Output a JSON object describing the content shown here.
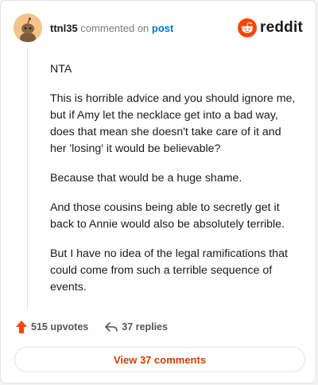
{
  "comment": {
    "username": "ttnl35",
    "commented_on": "commented on",
    "post_link": "post",
    "paragraphs": [
      "NTA",
      "This is horrible advice and you should ignore me, but if Amy let the necklace get into a bad way, does that mean she doesn't take care of it and her 'losing' it would be believable?",
      "Because that would be a huge shame.",
      "And those cousins being able to secretly get it back to Annie would also be absolutely terrible.",
      "But I have no idea of the legal ramifications that could come from such a terrible sequence of events."
    ],
    "upvotes": "515 upvotes",
    "replies": "37 replies",
    "view_button": "View 37 comments"
  },
  "brand": {
    "name": "reddit",
    "icon": "reddit-logo-icon",
    "color": "#ff4500"
  },
  "icons": {
    "avatar": "snoo-avatar",
    "upvote": "upvote-arrow-icon",
    "reply": "reply-arrow-icon"
  },
  "colors": {
    "accent": "#d93a00",
    "link": "#0079d3",
    "upvote": "#ff4500"
  }
}
